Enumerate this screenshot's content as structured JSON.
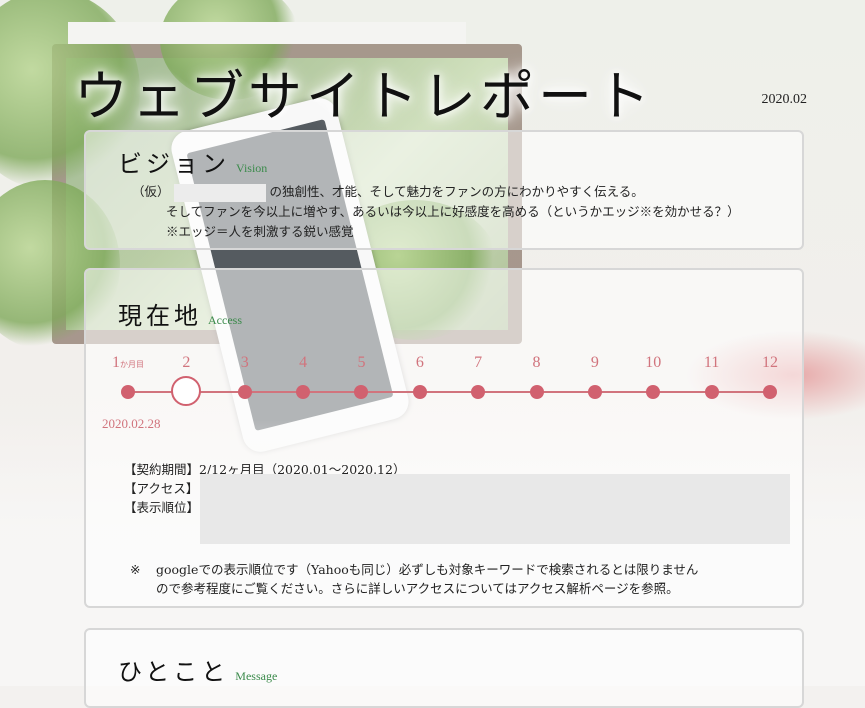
{
  "header": {
    "title": "ウェブサイトレポート",
    "date": "2020.02"
  },
  "vision": {
    "heading": "ビジョン",
    "heading_en": "Vision",
    "line1_prefix": "（仮）",
    "line1_suffix": "の独創性、才能、そして魅力をファンの方にわかりやすく伝える。",
    "line2": "そしてファンを今以上に増やす、あるいは今以上に好感度を高める（というかエッジ※を効かせる？）",
    "line3": "※エッジ＝人を刺激する鋭い感覚"
  },
  "access": {
    "heading": "現在地",
    "heading_en": "Access",
    "timeline": {
      "months": [
        "1",
        "2",
        "3",
        "4",
        "5",
        "6",
        "7",
        "8",
        "9",
        "10",
        "11",
        "12"
      ],
      "first_month_suffix": "か月目",
      "current_index": 1,
      "current_date": "2020.02.28",
      "accent_color": "#d1616f"
    },
    "contract": "【契約期間】2/12ヶ月目（2020.01～2020.12）",
    "access_label": "【アクセス】",
    "rank_label": "【表示順位】",
    "note_mark": "※",
    "note_line1": "googleでの表示順位です（Yahooも同じ）必ずしも対象キーワードで検索されるとは限りません",
    "note_line2": "ので参考程度にご覧ください。さらに詳しいアクセスについてはアクセス解析ページを参照。"
  },
  "message": {
    "heading": "ひとこと",
    "heading_en": "Message"
  }
}
